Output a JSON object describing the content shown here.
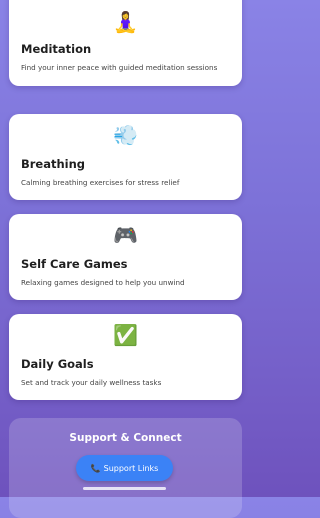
{
  "cards": [
    {
      "icon": "🧘‍♀️",
      "icon_name": "meditation-icon",
      "title": "Meditation",
      "description": "Find your inner peace with guided meditation sessions"
    },
    {
      "icon": "💨",
      "icon_name": "wind-icon",
      "title": "Breathing",
      "description": "Calming breathing exercises for stress relief"
    },
    {
      "icon": "🎮",
      "icon_name": "game-controller-icon",
      "title": "Self Care Games",
      "description": "Relaxing games designed to help you unwind"
    },
    {
      "icon": "✅",
      "icon_name": "check-mark-icon",
      "title": "Daily Goals",
      "description": "Set and track your daily wellness tasks"
    }
  ],
  "support": {
    "title": "Support & Connect",
    "button_icon": "📞",
    "button_icon_name": "phone-icon",
    "button_label": "Support Links"
  },
  "colors": {
    "background_top": "#8a83e6",
    "background_bottom": "#6e52bd",
    "card": "#ffffff",
    "button": "#3b82f6"
  }
}
